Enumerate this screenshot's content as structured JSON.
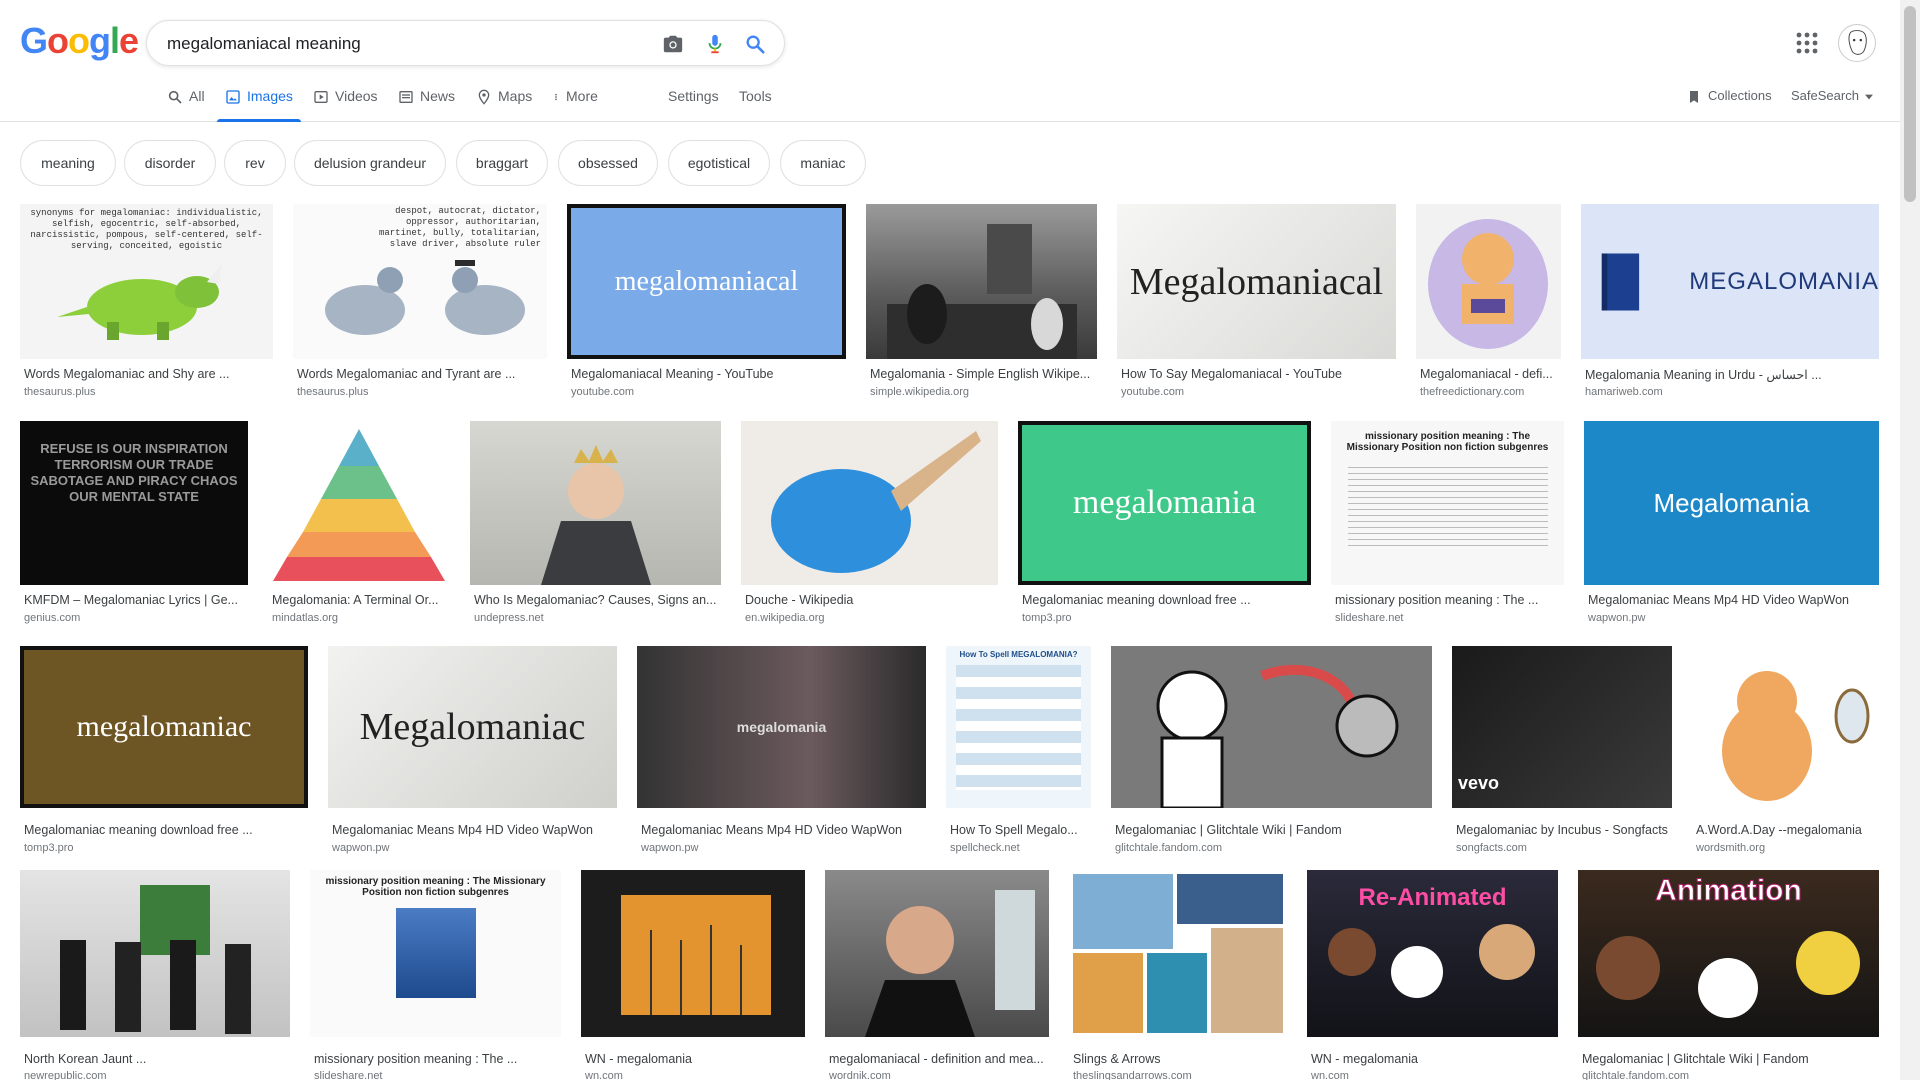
{
  "search": {
    "query": "megalomaniacal meaning"
  },
  "logo": {
    "letters": [
      "G",
      "o",
      "o",
      "g",
      "l",
      "e"
    ],
    "colors": [
      "#4285f4",
      "#ea4335",
      "#fbbc05",
      "#4285f4",
      "#34a853",
      "#ea4335"
    ]
  },
  "nav": {
    "all": "All",
    "images": "Images",
    "videos": "Videos",
    "news": "News",
    "maps": "Maps",
    "more": "More",
    "settings": "Settings",
    "tools": "Tools",
    "collections": "Collections",
    "safesearch": "SafeSearch"
  },
  "chips": [
    "meaning",
    "disorder",
    "rev",
    "delusion grandeur",
    "braggart",
    "obsessed",
    "egotistical",
    "maniac"
  ],
  "results": [
    {
      "caption": "Words Megalomaniac and Shy are ...",
      "source": "thesaurus.plus",
      "thumb_text": "synonyms for megalomaniac: individualistic, selfish, egocentric, self-absorbed, narcissistic, pompous, self-centered, self-serving, conceited, egoistic"
    },
    {
      "caption": "Words Megalomaniac and Tyrant are ...",
      "source": "thesaurus.plus",
      "thumb_text": "despot, autocrat, dictator, oppressor, authoritarian, martinet, bully, totalitarian, slave driver, absolute ruler"
    },
    {
      "caption": "Megalomaniacal Meaning - YouTube",
      "source": "youtube.com",
      "thumb_text": "megalomaniacal"
    },
    {
      "caption": "Megalomania - Simple English Wikipe...",
      "source": "simple.wikipedia.org",
      "thumb_text": ""
    },
    {
      "caption": "How To Say Megalomaniacal - YouTube",
      "source": "youtube.com",
      "thumb_text": "Megalomaniacal"
    },
    {
      "caption": "Megalomaniacal - defi...",
      "source": "thefreedictionary.com",
      "thumb_text": ""
    },
    {
      "caption": "Megalomania Meaning in Urdu - احساس ...",
      "source": "hamariweb.com",
      "thumb_text": "MEGALOMANIA"
    },
    {
      "caption": "KMFDM – Megalomaniac Lyrics | Ge...",
      "source": "genius.com",
      "thumb_text": "REFUSE IS OUR INSPIRATION TERRORISM OUR TRADE SABOTAGE AND PIRACY CHAOS OUR MENTAL STATE"
    },
    {
      "caption": "Megalomania: A Terminal Or...",
      "source": "mindatlas.org",
      "thumb_text": ""
    },
    {
      "caption": "Who Is Megalomaniac? Causes, Signs an...",
      "source": "undepress.net",
      "thumb_text": ""
    },
    {
      "caption": "Douche - Wikipedia",
      "source": "en.wikipedia.org",
      "thumb_text": ""
    },
    {
      "caption": "Megalomaniac meaning download free ...",
      "source": "tomp3.pro",
      "thumb_text": "megalomania"
    },
    {
      "caption": "missionary position meaning : The ...",
      "source": "slideshare.net",
      "thumb_text": "missionary position meaning : The Missionary Position non fiction subgenres"
    },
    {
      "caption": "Megalomaniac Means Mp4 HD Video WapWon",
      "source": "wapwon.pw",
      "thumb_text": "Megalomania"
    },
    {
      "caption": "Megalomaniac meaning download free ...",
      "source": "tomp3.pro",
      "thumb_text": "megalomaniac"
    },
    {
      "caption": "Megalomaniac Means Mp4 HD Video WapWon",
      "source": "wapwon.pw",
      "thumb_text": "Megalomaniac"
    },
    {
      "caption": "Megalomaniac Means Mp4 HD Video WapWon",
      "source": "wapwon.pw",
      "thumb_text": "megalomania"
    },
    {
      "caption": "How To Spell Megalo...",
      "source": "spellcheck.net",
      "thumb_text": "How To Spell MEGALOMANIA?"
    },
    {
      "caption": "Megalomaniac | Glitchtale Wiki | Fandom",
      "source": "glitchtale.fandom.com",
      "thumb_text": ""
    },
    {
      "caption": "Megalomaniac by Incubus - Songfacts",
      "source": "songfacts.com",
      "thumb_text": "vevo"
    },
    {
      "caption": "A.Word.A.Day --megalomania",
      "source": "wordsmith.org",
      "thumb_text": ""
    },
    {
      "caption": "North Korean Jaunt ...",
      "source": "newrepublic.com",
      "thumb_text": ""
    },
    {
      "caption": "missionary position meaning : The ...",
      "source": "slideshare.net",
      "thumb_text": "missionary position meaning : The Missionary Position non fiction subgenres"
    },
    {
      "caption": "WN - megalomania",
      "source": "wn.com",
      "thumb_text": ""
    },
    {
      "caption": "megalomaniacal - definition and mea...",
      "source": "wordnik.com",
      "thumb_text": ""
    },
    {
      "caption": "Slings & Arrows",
      "source": "theslingsandarrows.com",
      "thumb_text": ""
    },
    {
      "caption": "WN - megalomania",
      "source": "wn.com",
      "thumb_text": "Re-Animated"
    },
    {
      "caption": "Megalomaniac | Glitchtale Wiki | Fandom",
      "source": "glitchtale.fandom.com",
      "thumb_text": "Animation"
    }
  ]
}
